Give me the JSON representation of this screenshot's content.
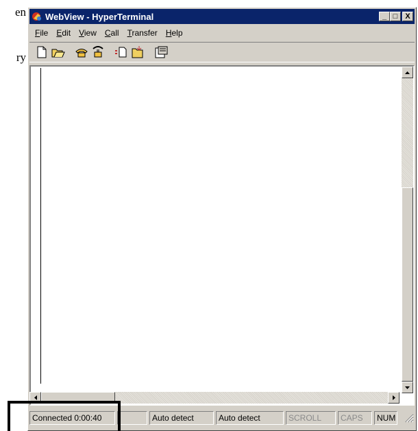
{
  "doc_fragments": [
    "en",
    "ry"
  ],
  "window": {
    "title": "WebView - HyperTerminal",
    "minimize": "_",
    "maximize": "□",
    "close": "X"
  },
  "menu": [
    {
      "first": "F",
      "rest": "ile"
    },
    {
      "first": "E",
      "rest": "dit"
    },
    {
      "first": "V",
      "rest": "iew"
    },
    {
      "first": "C",
      "rest": "all"
    },
    {
      "first": "T",
      "rest": "ransfer"
    },
    {
      "first": "H",
      "rest": "elp"
    }
  ],
  "toolbar": [
    "new-icon",
    "open-icon",
    "connect-icon",
    "disconnect-icon",
    "send-icon",
    "receive-icon",
    "properties-icon"
  ],
  "status": {
    "connection": "Connected 0:00:40",
    "blank": "",
    "emulation": "Auto detect",
    "settings": "Auto detect",
    "scroll": "SCROLL",
    "caps": "CAPS",
    "num": "NUM"
  },
  "colors": {
    "titlebar": "#0a246a",
    "face": "#d4d0c8"
  }
}
